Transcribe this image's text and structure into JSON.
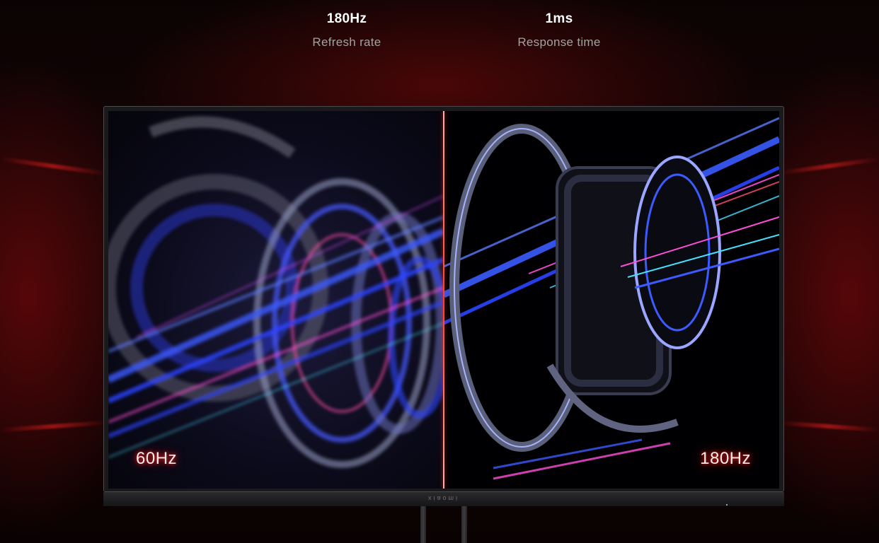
{
  "specs": [
    {
      "value": "180Hz",
      "label": "Refresh rate"
    },
    {
      "value": "1ms",
      "label": "Response time"
    }
  ],
  "comparison": {
    "left_label": "60Hz",
    "right_label": "180Hz"
  },
  "colors": {
    "accent_red": "#ff3b2e",
    "neon_blue": "#3b5bff",
    "neon_pink": "#ff4fd8"
  }
}
